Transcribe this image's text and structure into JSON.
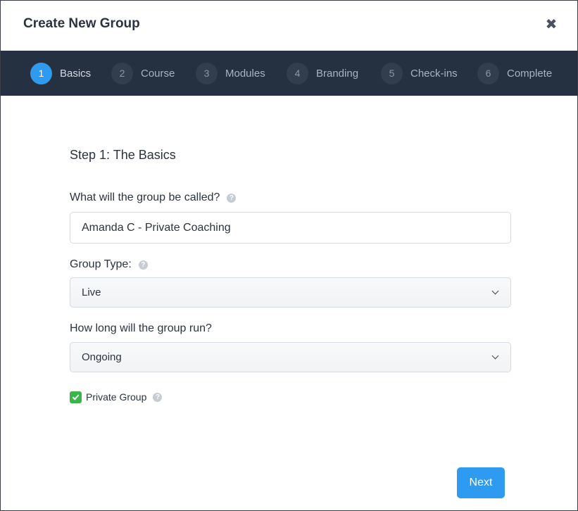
{
  "modal": {
    "title": "Create New Group",
    "close_icon": "close-icon"
  },
  "stepper": {
    "steps": [
      {
        "number": "1",
        "label": "Basics",
        "active": true
      },
      {
        "number": "2",
        "label": "Course",
        "active": false
      },
      {
        "number": "3",
        "label": "Modules",
        "active": false
      },
      {
        "number": "4",
        "label": "Branding",
        "active": false
      },
      {
        "number": "5",
        "label": "Check-ins",
        "active": false
      },
      {
        "number": "6",
        "label": "Complete",
        "active": false
      }
    ]
  },
  "form": {
    "section_title": "Step 1: The Basics",
    "group_name": {
      "label": "What will the group be called?",
      "value": "Amanda C - Private Coaching"
    },
    "group_type": {
      "label": "Group Type:",
      "value": "Live"
    },
    "duration": {
      "label": "How long will the group run?",
      "value": "Ongoing"
    },
    "private_group": {
      "label": "Private Group",
      "checked": true
    },
    "help_icon": "?"
  },
  "footer": {
    "next_label": "Next"
  },
  "colors": {
    "accent": "#2e9bf0",
    "stepper_bg": "#253041",
    "checkbox_green": "#3bb54a"
  }
}
